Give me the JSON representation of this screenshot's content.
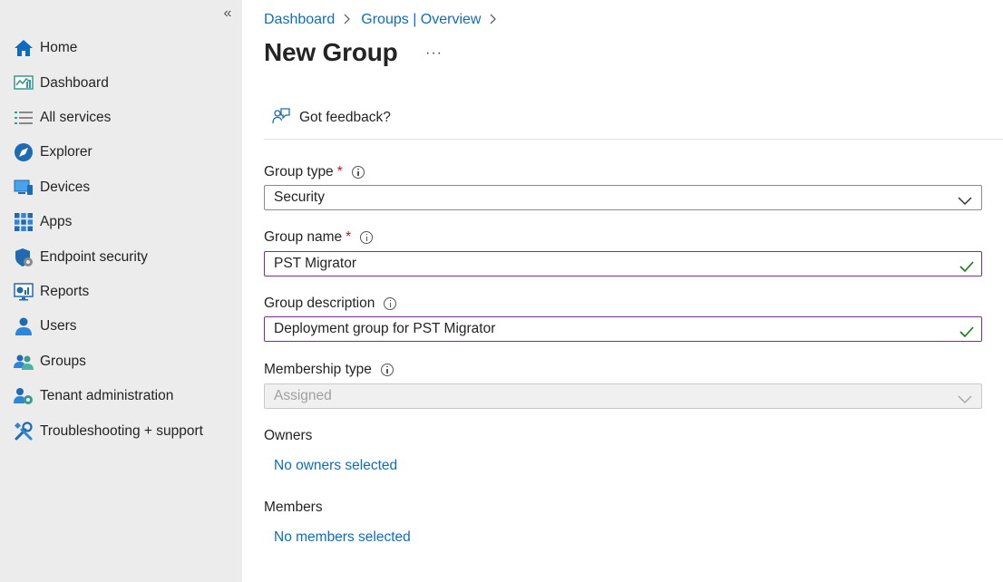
{
  "sidebar": {
    "collapse_glyph": "«",
    "items": [
      {
        "label": "Home",
        "icon": "home-icon"
      },
      {
        "label": "Dashboard",
        "icon": "dashboard-icon"
      },
      {
        "label": "All services",
        "icon": "list-icon"
      },
      {
        "label": "Explorer",
        "icon": "explorer-icon"
      },
      {
        "label": "Devices",
        "icon": "devices-icon"
      },
      {
        "label": "Apps",
        "icon": "apps-grid-icon"
      },
      {
        "label": "Endpoint security",
        "icon": "shield-icon"
      },
      {
        "label": "Reports",
        "icon": "reports-icon"
      },
      {
        "label": "Users",
        "icon": "user-icon"
      },
      {
        "label": "Groups",
        "icon": "groups-icon"
      },
      {
        "label": "Tenant administration",
        "icon": "tenant-admin-icon"
      },
      {
        "label": "Troubleshooting + support",
        "icon": "tools-icon"
      }
    ]
  },
  "breadcrumb": {
    "items": [
      "Dashboard",
      "Groups | Overview"
    ]
  },
  "page": {
    "title": "New Group",
    "more": "···"
  },
  "toolbar": {
    "feedback_label": "Got feedback?"
  },
  "form": {
    "group_type": {
      "label": "Group type",
      "required": "*",
      "value": "Security"
    },
    "group_name": {
      "label": "Group name",
      "required": "*",
      "value": "PST Migrator"
    },
    "group_description": {
      "label": "Group description",
      "value": "Deployment group for PST Migrator"
    },
    "membership_type": {
      "label": "Membership type",
      "value": "Assigned"
    },
    "owners": {
      "label": "Owners",
      "link": "No owners selected"
    },
    "members": {
      "label": "Members",
      "link": "No members selected"
    }
  },
  "colors": {
    "accent": "#0f6cbd",
    "valid_border": "#7a2f8c",
    "check": "#107c10",
    "required": "#c50f1f"
  }
}
